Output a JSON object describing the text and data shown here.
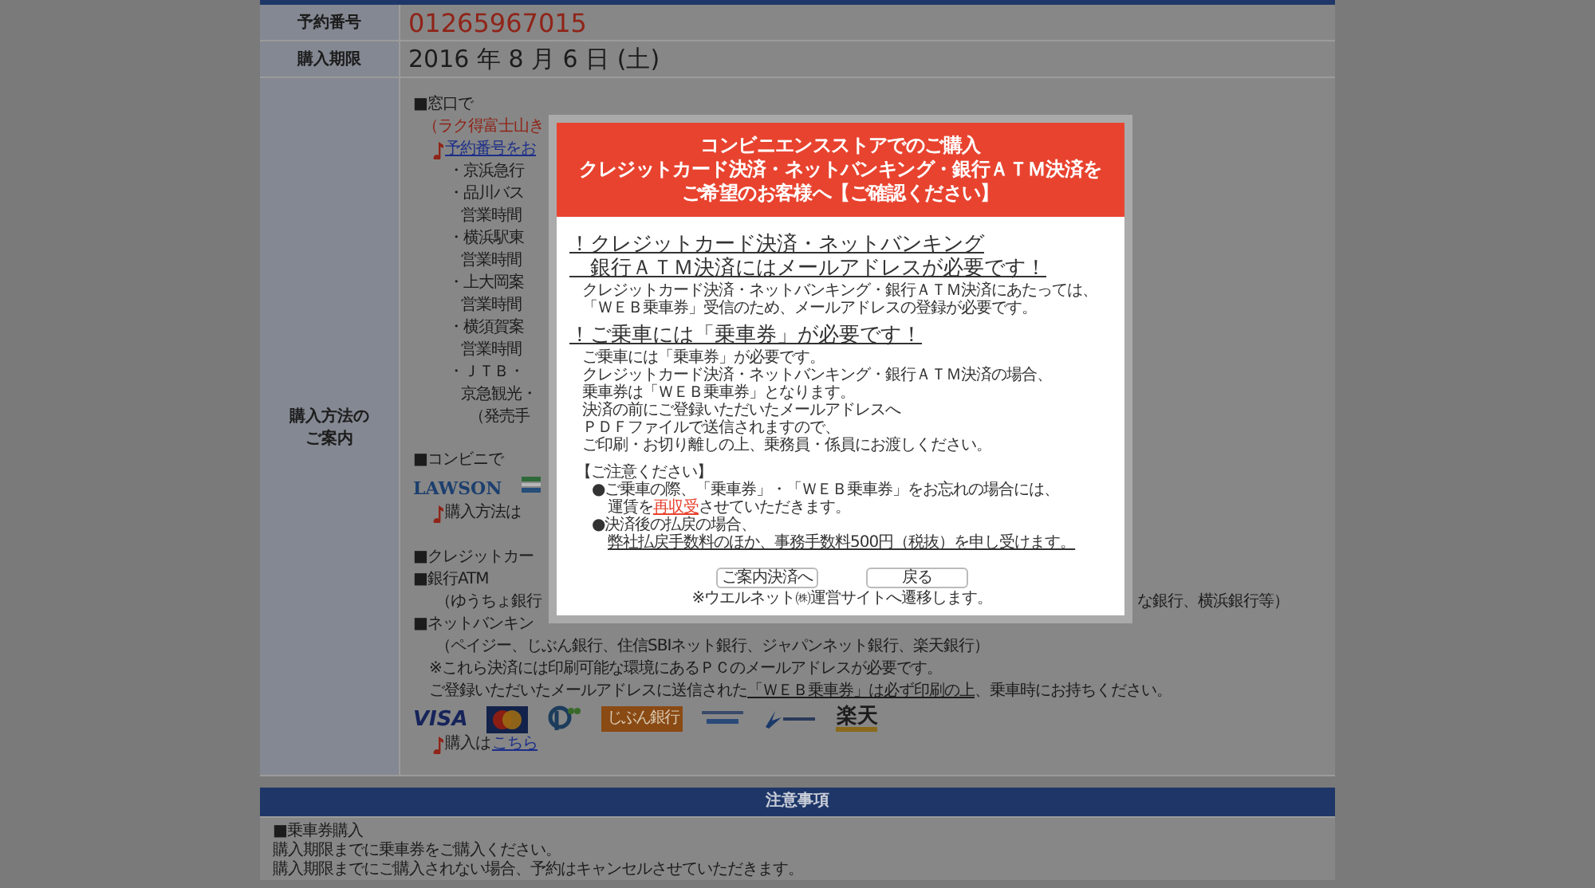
{
  "reservation": [
    {
      "label": "予約番号",
      "value": "01265967015",
      "kind": "number"
    },
    {
      "label": "購入期限",
      "value": "2016 年 8 月 6 日 (土)",
      "kind": "date"
    }
  ],
  "guide": {
    "label": "購入方法のご案内",
    "sections": [
      {
        "lines": [
          {
            "kind": "heading",
            "text": "■窓口で"
          },
          {
            "kind": "caution",
            "text": "（ラク得富士山き"
          },
          {
            "kind": "note",
            "link": "予約番号をお"
          },
          {
            "kind": "item",
            "text": "・京浜急行"
          },
          {
            "kind": "item",
            "text": "・品川バス"
          },
          {
            "kind": "detail",
            "text": "営業時間"
          },
          {
            "kind": "item",
            "text": "・横浜駅東"
          },
          {
            "kind": "detail",
            "text": "営業時間"
          },
          {
            "kind": "item",
            "text": "・上大岡案"
          },
          {
            "kind": "detail",
            "text": "営業時間"
          },
          {
            "kind": "item",
            "text": "・横須賀案"
          },
          {
            "kind": "detail",
            "text": "営業時間"
          },
          {
            "kind": "item",
            "text": "・ＪＴＢ・"
          },
          {
            "kind": "detail",
            "text": "京急観光・"
          },
          {
            "kind": "fee",
            "text": "（発売手"
          }
        ]
      },
      {
        "lines": [
          {
            "kind": "heading",
            "text": "■コンビニで"
          },
          {
            "kind": "logos",
            "logos": [
              {
                "kind": "lawson",
                "text": "LAWSON"
              },
              {
                "kind": "stripes"
              }
            ]
          },
          {
            "kind": "note",
            "text": "購入方法は"
          }
        ]
      },
      {
        "lines": [
          {
            "kind": "heading",
            "text": "■クレジットカー"
          },
          {
            "kind": "heading",
            "text": "■銀行ATM"
          },
          {
            "kind": "paren",
            "text": "（ゆうちょ銀行",
            "tail": "な銀行、横浜銀行等）"
          },
          {
            "kind": "heading",
            "text": "■ネットバンキン"
          },
          {
            "kind": "paren",
            "text": "（ペイジー、じぶん銀行、住信SBIネット銀行、ジャパンネット銀行、楽天銀行）"
          },
          {
            "kind": "remark",
            "text": "※これら決済には印刷可能な環境にあるＰＣのメールアドレスが必要です。"
          },
          {
            "kind": "remark",
            "segments": [
              {
                "text": "ご登録いただいたメールアドレスに送信された",
                "kind": "text"
              },
              {
                "text": "「ＷＥＢ乗車券」は必ず印刷の上",
                "kind": "link"
              },
              {
                "text": "、乗車時にお持ちください。",
                "kind": "text"
              }
            ]
          },
          {
            "kind": "logos",
            "logos": [
              {
                "kind": "visa",
                "text": "VISA"
              },
              {
                "kind": "mastercard"
              },
              {
                "kind": "payeasy"
              },
              {
                "kind": "jibun",
                "text": "じぶん銀行"
              },
              {
                "kind": "sumishin"
              },
              {
                "kind": "japannet"
              },
              {
                "kind": "rakuten",
                "text": "楽天"
              }
            ]
          },
          {
            "kind": "note",
            "text": "購入は",
            "link": "こちら"
          }
        ]
      }
    ]
  },
  "notice": {
    "title": "注意事項",
    "lines": [
      "■乗車券購入",
      "購入期限までに乗車券をご購入ください。",
      "購入期限までにご購入されない場合、予約はキャンセルさせていただきます。"
    ]
  },
  "dialog": {
    "title_lines": [
      "コンビニエンスストアでのご購入",
      "クレジットカード決済・ネットバンキング・銀行ＡＴＭ決済を",
      "ご希望のお客様へ【ご確認ください】"
    ],
    "blocks": [
      {
        "kind": "heading",
        "lines": [
          "！クレジットカード決済・ネットバンキング",
          "　銀行ＡＴＭ決済にはメールアドレスが必要です！"
        ]
      },
      {
        "kind": "text",
        "lines": [
          "クレジットカード決済・ネットバンキング・銀行ＡＴＭ決済にあたっては、",
          "「ＷＥＢ乗車券」受信のため、メールアドレスの登録が必要です。"
        ]
      },
      {
        "kind": "heading",
        "lines": [
          "！ご乗車には「乗車券」が必要です！"
        ]
      },
      {
        "kind": "text",
        "lines": [
          "ご乗車には「乗車券」が必要です。",
          "クレジットカード決済・ネットバンキング・銀行ＡＴＭ決済の場合、",
          "乗車券は「ＷＥＢ乗車券」となります。",
          "決済の前にご登録いただいたメールアドレスへ",
          "ＰＤＦファイルで送信されますので、",
          "ご印刷・お切り離しの上、乗務員・係員にお渡しください。"
        ]
      },
      {
        "kind": "caution_title",
        "lines": [
          "【ご注意ください】"
        ]
      }
    ],
    "cautions": [
      [
        [
          {
            "text": "●ご乗車の際、「乗車券」・「ＷＥＢ乗車券」をお忘れの場合には、",
            "kind": "text"
          }
        ],
        [
          {
            "text": "運賃を",
            "kind": "text"
          },
          {
            "text": "再収受",
            "kind": "warning"
          },
          {
            "text": "させていただきます。",
            "kind": "text"
          }
        ]
      ],
      [
        [
          {
            "text": "●決済後の払戻の場合、",
            "kind": "text"
          }
        ],
        [
          {
            "text": "弊社払戻手数料のほか、事務手数料500円（税抜）を申し受けます。",
            "kind": "link"
          }
        ]
      ]
    ],
    "buttons": [
      "ご案内決済へ",
      "戻る"
    ],
    "footnote": "※ウエルネット㈱運営サイトへ遷移します。"
  }
}
